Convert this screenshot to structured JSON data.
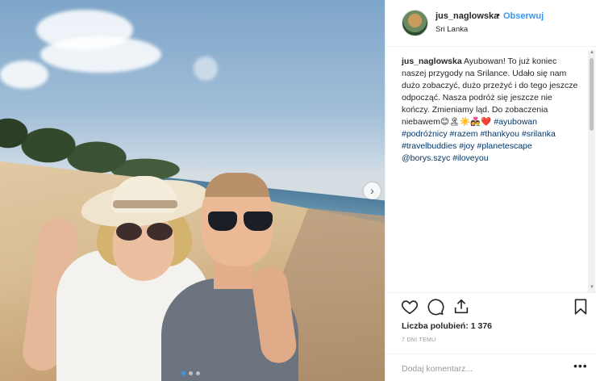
{
  "post": {
    "photo_alt": "",
    "dots_count": 3,
    "active_dot": 0
  },
  "header": {
    "username": "jus_naglowska",
    "separator": "•",
    "follow_label": "Obserwuj",
    "location": "Sri Lanka"
  },
  "caption": {
    "username": "jus_naglowska",
    "text": "Ayubowan! To już koniec naszej przygody na Srilance. Udało się nam dużo zobaczyć, dużo przeżyć i do tego jeszcze odpocząć. Nasza podróż się jeszcze nie kończy. Zmieniamy ląd. Do zobaczenia niebawem😊🏝☀️👩‍❤️‍👨❤️",
    "tags": [
      "#ayubowan",
      "#podróżnicy",
      "#razem",
      "#thankyou",
      "#srilanka",
      "#travelbuddies",
      "#joy",
      "#planetescape",
      "@borys.szyc",
      "#iloveyou"
    ]
  },
  "actions": {
    "like_icon": "heart-icon",
    "comment_icon": "comment-icon",
    "share_icon": "share-icon",
    "save_icon": "bookmark-icon"
  },
  "stats": {
    "likes_label": "Liczba polubień: 1 376",
    "time": "7 DNI TEMU"
  },
  "comment": {
    "placeholder": "Dodaj komentarz...",
    "more_label": "•••"
  },
  "colors": {
    "link": "#3897f0",
    "hashtag": "#003569",
    "text": "#262626",
    "muted": "#999999"
  }
}
